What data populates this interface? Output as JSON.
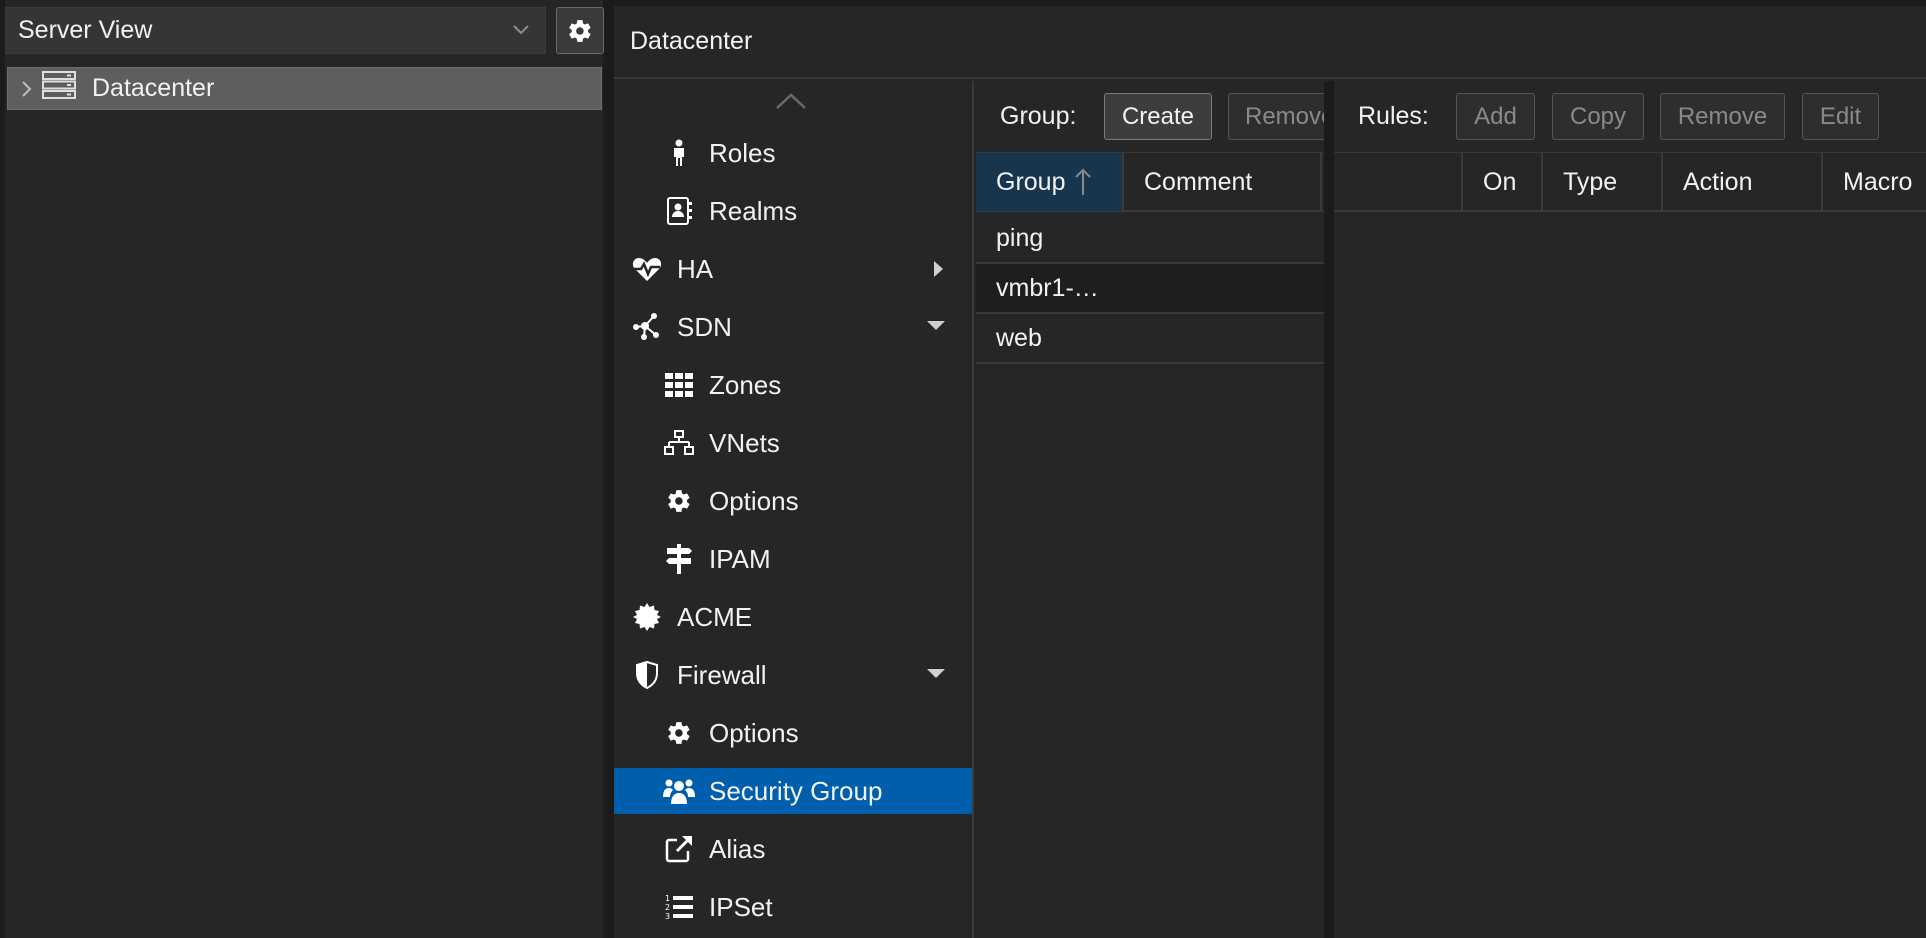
{
  "left_panel": {
    "view_selector": {
      "value": "Server View"
    },
    "tree": {
      "root_label": "Datacenter"
    }
  },
  "main": {
    "title": "Datacenter"
  },
  "nav": {
    "items": [
      {
        "label": "Roles",
        "icon": "person-icon",
        "level": 2
      },
      {
        "label": "Realms",
        "icon": "address-book-icon",
        "level": 2
      },
      {
        "label": "HA",
        "icon": "heartbeat-icon",
        "level": 1,
        "state": "collapsed"
      },
      {
        "label": "SDN",
        "icon": "sdn-icon",
        "level": 1,
        "state": "expanded"
      },
      {
        "label": "Zones",
        "icon": "grid-icon",
        "level": 2
      },
      {
        "label": "VNets",
        "icon": "network-icon",
        "level": 2
      },
      {
        "label": "Options",
        "icon": "gear-icon",
        "level": 2
      },
      {
        "label": "IPAM",
        "icon": "signpost-icon",
        "level": 2
      },
      {
        "label": "ACME",
        "icon": "certificate-icon",
        "level": 1
      },
      {
        "label": "Firewall",
        "icon": "shield-icon",
        "level": 1,
        "state": "expanded"
      },
      {
        "label": "Options",
        "icon": "gear-icon",
        "level": 2
      },
      {
        "label": "Security Group",
        "icon": "users-icon",
        "level": 2,
        "selected": true
      },
      {
        "label": "Alias",
        "icon": "external-link-icon",
        "level": 2
      },
      {
        "label": "IPSet",
        "icon": "numbered-list-icon",
        "level": 2
      }
    ]
  },
  "group_panel": {
    "toolbar": {
      "label": "Group:",
      "create": "Create",
      "remove": "Remove"
    },
    "columns": {
      "group": "Group",
      "comment": "Comment"
    },
    "rows": [
      "ping",
      "vmbr1-…",
      "web"
    ]
  },
  "rules_panel": {
    "toolbar": {
      "label": "Rules:",
      "add": "Add",
      "copy": "Copy",
      "remove": "Remove",
      "edit": "Edit"
    },
    "columns": {
      "on": "On",
      "type": "Type",
      "action": "Action",
      "macro": "Macro"
    }
  },
  "colors": {
    "accent": "#005fad",
    "background": "#262626",
    "header_sorted": "#17354d"
  }
}
